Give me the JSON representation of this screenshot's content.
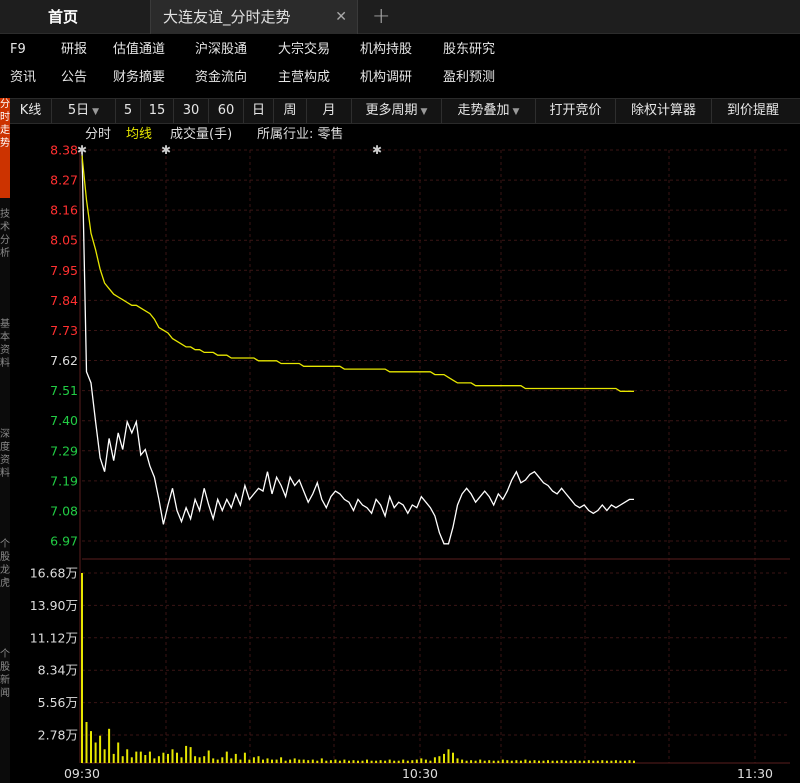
{
  "tabs": {
    "home": "首页",
    "active": "大连友谊_分时走势",
    "close_icon": "close-icon",
    "add_icon": "plus-icon"
  },
  "menu": {
    "row1": [
      "F9",
      "研报",
      "估值通道",
      "沪深股通",
      "大宗交易",
      "机构持股",
      "股东研究"
    ],
    "row2": [
      "资讯",
      "公告",
      "财务摘要",
      "资金流向",
      "主营构成",
      "机构调研",
      "盈利预测"
    ]
  },
  "toolbar": {
    "items": [
      "K线",
      "5日",
      "5",
      "15",
      "30",
      "60",
      "日",
      "周",
      "月",
      "更多周期",
      "走势叠加",
      "打开竞价",
      "除权计算器",
      "到价提醒"
    ]
  },
  "side_tabs": [
    {
      "label": "分时走势",
      "active": true
    },
    {
      "label": "技术分析",
      "active": false
    },
    {
      "label": "基本资料",
      "active": false
    },
    {
      "label": "深度资料",
      "active": false
    },
    {
      "label": "个股龙虎",
      "active": false
    },
    {
      "label": "个股新闻",
      "active": false
    }
  ],
  "legend": {
    "time": "分时",
    "avg": "均线",
    "volume": "成交量(手)",
    "industry": "所属行业: 零售"
  },
  "colors": {
    "up": "#ff3030",
    "down": "#22cc44",
    "price_line": "#ffffff",
    "avg_line": "#e6e600",
    "volume_bar": "#e6e600",
    "grid": "#3a1515",
    "tab_active": "#cc3300"
  },
  "chart_data": {
    "type": "line",
    "x_ticks": [
      "09:30",
      "10:30",
      "11:30"
    ],
    "price_ticks": [
      "8.38",
      "8.27",
      "8.16",
      "8.05",
      "7.95",
      "7.84",
      "7.73",
      "7.62",
      "7.51",
      "7.40",
      "7.29",
      "7.19",
      "7.08",
      "6.97"
    ],
    "volume_ticks": [
      "16.68万",
      "13.90万",
      "11.12万",
      "8.34万",
      "5.56万",
      "2.78万"
    ],
    "prev_close": 7.62,
    "ylim": [
      6.97,
      8.38
    ],
    "volume_ylim": [
      0,
      166800
    ],
    "series": [
      {
        "name": "分时",
        "values": [
          8.38,
          7.58,
          7.54,
          7.4,
          7.27,
          7.22,
          7.34,
          7.26,
          7.36,
          7.3,
          7.4,
          7.36,
          7.4,
          7.28,
          7.3,
          7.24,
          7.2,
          7.12,
          7.03,
          7.1,
          7.16,
          7.08,
          7.04,
          7.09,
          7.05,
          7.12,
          7.08,
          7.16,
          7.1,
          7.05,
          7.12,
          7.08,
          7.12,
          7.09,
          7.14,
          7.1,
          7.17,
          7.12,
          7.14,
          7.16,
          7.15,
          7.22,
          7.14,
          7.2,
          7.17,
          7.13,
          7.2,
          7.17,
          7.19,
          7.15,
          7.11,
          7.14,
          7.18,
          7.12,
          7.09,
          7.13,
          7.15,
          7.14,
          7.12,
          7.11,
          7.08,
          7.12,
          7.1,
          7.09,
          7.07,
          7.12,
          7.1,
          7.06,
          7.13,
          7.09,
          7.11,
          7.1,
          7.07,
          7.1,
          7.09,
          7.13,
          7.11,
          7.09,
          7.06,
          7.0,
          6.96,
          6.96,
          7.02,
          7.1,
          7.14,
          7.16,
          7.14,
          7.11,
          7.13,
          7.15,
          7.13,
          7.1,
          7.14,
          7.12,
          7.15,
          7.19,
          7.22,
          7.18,
          7.19,
          7.21,
          7.22,
          7.2,
          7.18,
          7.17,
          7.15,
          7.14,
          7.16,
          7.14,
          7.12,
          7.1,
          7.09,
          7.1,
          7.08,
          7.07,
          7.08,
          7.1,
          7.08,
          7.1,
          7.09,
          7.1,
          7.11,
          7.12,
          7.12
        ]
      },
      {
        "name": "均线",
        "values": [
          8.36,
          8.2,
          8.08,
          8.02,
          7.95,
          7.9,
          7.88,
          7.86,
          7.85,
          7.84,
          7.83,
          7.82,
          7.82,
          7.81,
          7.8,
          7.79,
          7.77,
          7.74,
          7.73,
          7.72,
          7.7,
          7.69,
          7.68,
          7.67,
          7.67,
          7.66,
          7.66,
          7.65,
          7.65,
          7.65,
          7.64,
          7.64,
          7.64,
          7.63,
          7.63,
          7.63,
          7.63,
          7.63,
          7.63,
          7.62,
          7.62,
          7.62,
          7.62,
          7.62,
          7.61,
          7.61,
          7.61,
          7.61,
          7.61,
          7.6,
          7.6,
          7.6,
          7.6,
          7.6,
          7.6,
          7.6,
          7.6,
          7.6,
          7.59,
          7.59,
          7.59,
          7.59,
          7.59,
          7.59,
          7.59,
          7.59,
          7.59,
          7.59,
          7.58,
          7.58,
          7.58,
          7.58,
          7.58,
          7.58,
          7.58,
          7.58,
          7.58,
          7.58,
          7.57,
          7.57,
          7.57,
          7.56,
          7.55,
          7.54,
          7.54,
          7.54,
          7.54,
          7.53,
          7.53,
          7.53,
          7.53,
          7.53,
          7.53,
          7.53,
          7.53,
          7.53,
          7.53,
          7.53,
          7.52,
          7.52,
          7.52,
          7.52,
          7.52,
          7.52,
          7.52,
          7.52,
          7.52,
          7.52,
          7.52,
          7.52,
          7.52,
          7.52,
          7.52,
          7.52,
          7.52,
          7.52,
          7.52,
          7.52,
          7.52,
          7.51,
          7.51,
          7.51,
          7.51
        ]
      }
    ],
    "volume": [
      166800,
      36000,
      28000,
      18000,
      24000,
      12000,
      30000,
      8000,
      18000,
      6000,
      12000,
      5000,
      10000,
      10000,
      7000,
      10000,
      4000,
      6000,
      9000,
      8000,
      12000,
      9000,
      5000,
      15000,
      14000,
      6000,
      5000,
      6000,
      11000,
      4000,
      3000,
      5000,
      10000,
      4000,
      8000,
      3000,
      9000,
      3000,
      5000,
      6000,
      3000,
      4000,
      3000,
      3000,
      5000,
      2000,
      3000,
      4000,
      3000,
      3000,
      2500,
      3000,
      2000,
      4000,
      2000,
      2500,
      3000,
      2000,
      3000,
      2000,
      2500,
      2000,
      2000,
      3000,
      2000,
      2000,
      2500,
      2000,
      3000,
      2000,
      2000,
      3000,
      2000,
      2500,
      3000,
      4000,
      3000,
      2000,
      5000,
      6000,
      8000,
      12000,
      9000,
      4000,
      3000,
      2000,
      2500,
      2000,
      3000,
      2000,
      2500,
      2000,
      2000,
      3000,
      2500,
      2000,
      2500,
      2000,
      3000,
      2000,
      2500,
      2000,
      2000,
      2500,
      2000,
      2000,
      2500,
      2000,
      2000,
      2500,
      2000,
      2000,
      2500,
      2000,
      2000,
      2500,
      2000,
      2000,
      2500,
      2000,
      2000,
      2500,
      2000
    ]
  }
}
